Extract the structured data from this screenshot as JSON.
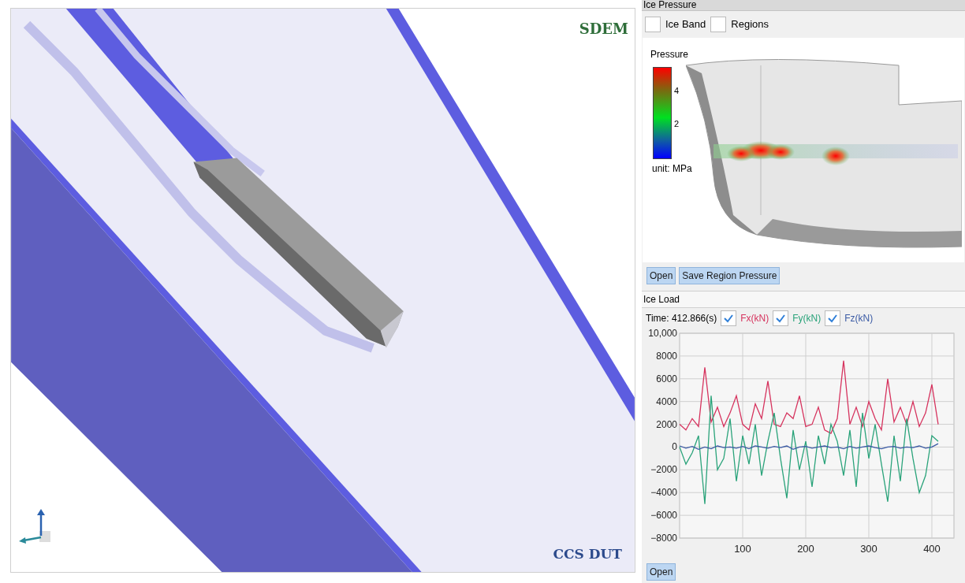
{
  "viewport": {
    "logo_top": "SDEM",
    "logo_bottom": "CCS DUT"
  },
  "ice_pressure": {
    "title": "Ice Pressure",
    "toggles": [
      {
        "label": "Ice Band",
        "checked": false
      },
      {
        "label": "Regions",
        "checked": false
      }
    ],
    "legend": {
      "title": "Pressure",
      "ticks": [
        "4",
        "2"
      ],
      "unit": "unit: MPa"
    },
    "buttons": [
      "Open",
      "Save Region Pressure"
    ]
  },
  "ice_load": {
    "title": "Ice Load",
    "time": "Time: 412.866(s)",
    "series_toggles": [
      {
        "checked": true
      },
      {
        "checked": true
      },
      {
        "checked": true
      }
    ],
    "chart_data": {
      "type": "line",
      "grid": true,
      "x": [
        0,
        10,
        20,
        30,
        40,
        50,
        60,
        70,
        80,
        90,
        100,
        110,
        120,
        130,
        140,
        150,
        160,
        170,
        180,
        190,
        200,
        210,
        220,
        230,
        240,
        250,
        260,
        270,
        280,
        290,
        300,
        310,
        320,
        330,
        340,
        350,
        360,
        370,
        380,
        390,
        400,
        410
      ],
      "xlim": [
        0,
        435
      ],
      "ylim": [
        -8000,
        10000
      ],
      "xticks": [
        100,
        200,
        300,
        400
      ],
      "yticks": [
        {
          "value": 10000,
          "label": "10,000"
        },
        {
          "value": 8000,
          "label": "8000"
        },
        {
          "value": 6000,
          "label": "6000"
        },
        {
          "value": 4000,
          "label": "4000"
        },
        {
          "value": 2000,
          "label": "2000"
        },
        {
          "value": 0,
          "label": "0"
        },
        {
          "value": -2000,
          "label": "−2000"
        },
        {
          "value": -4000,
          "label": "−4000"
        },
        {
          "value": -6000,
          "label": "−6000"
        },
        {
          "value": -8000,
          "label": "−8000"
        }
      ],
      "series": [
        {
          "name": "Fx(kN)",
          "color": "#d6335e",
          "values": [
            2000,
            1500,
            2500,
            1800,
            7000,
            2200,
            3500,
            1800,
            3000,
            4500,
            2000,
            1500,
            3800,
            2500,
            5800,
            2000,
            1800,
            3000,
            2500,
            4500,
            1800,
            2000,
            3500,
            1500,
            1200,
            2500,
            7600,
            2000,
            3500,
            1800,
            4000,
            2500,
            1500,
            6000,
            2200,
            3500,
            2000,
            4000,
            1800,
            3000,
            5500,
            2000
          ]
        },
        {
          "name": "Fy(kN)",
          "color": "#2aa37a",
          "values": [
            0,
            -1500,
            -500,
            1000,
            -5000,
            4500,
            -2000,
            -1000,
            2500,
            -3000,
            1000,
            -1500,
            2000,
            -2500,
            500,
            3000,
            -1000,
            -4500,
            1500,
            -2000,
            500,
            -3500,
            1000,
            -1500,
            2000,
            500,
            -2500,
            1500,
            -3500,
            3000,
            -1000,
            2000,
            -1500,
            -4800,
            1000,
            -3000,
            2500,
            -1000,
            -4000,
            -2500,
            1000,
            500
          ]
        },
        {
          "name": "Fz(kN)",
          "color": "#3b5ba5",
          "values": [
            100,
            -100,
            50,
            -200,
            0,
            -150,
            100,
            -50,
            0,
            -100,
            50,
            -150,
            100,
            0,
            -100,
            50,
            -50,
            100,
            -200,
            0,
            50,
            -100,
            0,
            100,
            -50,
            0,
            -150,
            50,
            -100,
            0,
            100,
            -50,
            -150,
            0,
            50,
            -100,
            0,
            -50,
            100,
            -100,
            0,
            300
          ]
        }
      ]
    },
    "buttons": [
      "Open"
    ]
  }
}
